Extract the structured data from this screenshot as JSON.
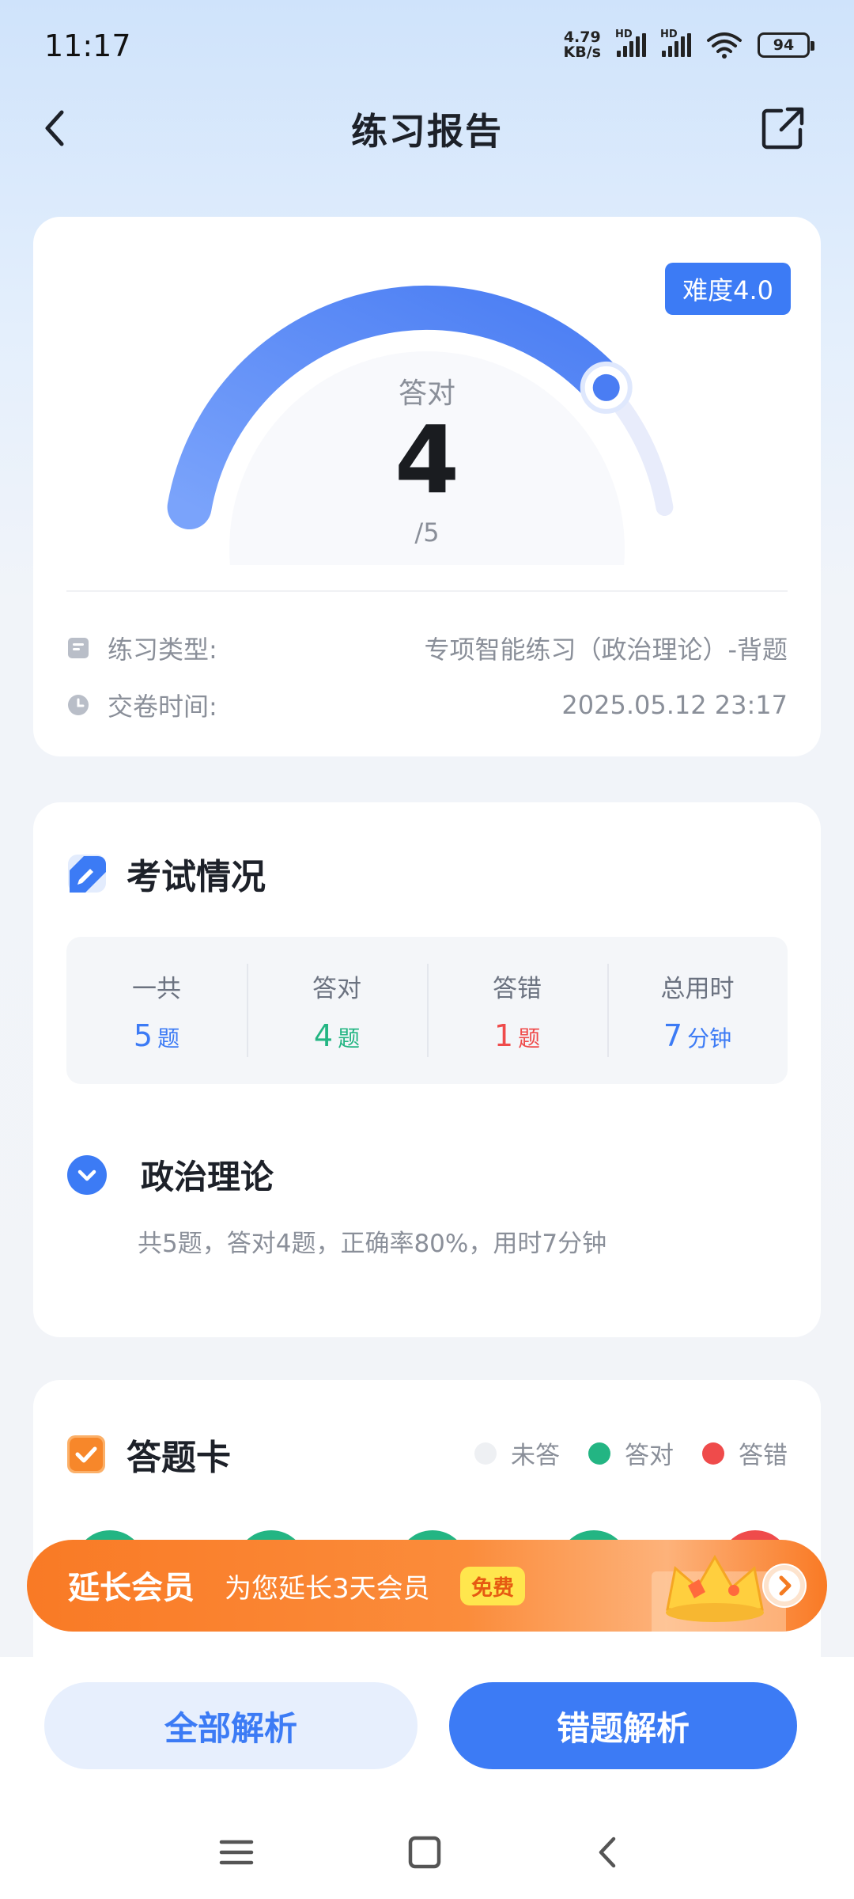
{
  "status_bar": {
    "time": "11:17",
    "net_speed_value": "4.79",
    "net_speed_unit": "KB/s",
    "signal_label": "HD",
    "battery": "94"
  },
  "nav": {
    "title": "练习报告"
  },
  "score": {
    "difficulty": "难度4.0",
    "label": "答对",
    "correct": "4",
    "total": "/5",
    "progress_fraction": 0.8
  },
  "info": {
    "type_label": "练习类型:",
    "type_value": "专项智能练习（政治理论）-背题",
    "time_label": "交卷时间:",
    "time_value": "2025.05.12 23:17"
  },
  "exam": {
    "title": "考试情况",
    "stats": [
      {
        "label": "一共",
        "value": "5",
        "unit": "题",
        "color": "#3c7bf5"
      },
      {
        "label": "答对",
        "value": "4",
        "unit": "题",
        "color": "#23b583"
      },
      {
        "label": "答错",
        "value": "1",
        "unit": "题",
        "color": "#ef4b4b"
      },
      {
        "label": "总用时",
        "value": "7",
        "unit": "分钟",
        "color": "#3c7bf5"
      }
    ],
    "subject_title": "政治理论",
    "subject_summary": "共5题，答对4题，正确率80%，用时7分钟"
  },
  "answer_card": {
    "title": "答题卡",
    "legend": [
      {
        "label": "未答",
        "color": "#eef0f3"
      },
      {
        "label": "答对",
        "color": "#23b583"
      },
      {
        "label": "答错",
        "color": "#ef4b4b"
      }
    ],
    "question_states": [
      "correct",
      "correct",
      "correct",
      "correct",
      "wrong"
    ]
  },
  "promo": {
    "title": "延长会员",
    "subtitle": "为您延长3天会员",
    "badge": "免费"
  },
  "bottom": {
    "all_analysis": "全部解析",
    "wrong_analysis": "错题解析"
  },
  "colors": {
    "accent": "#3c7bf5",
    "correct": "#23b583",
    "wrong": "#ef4b4b",
    "promo": "#f97a25"
  }
}
